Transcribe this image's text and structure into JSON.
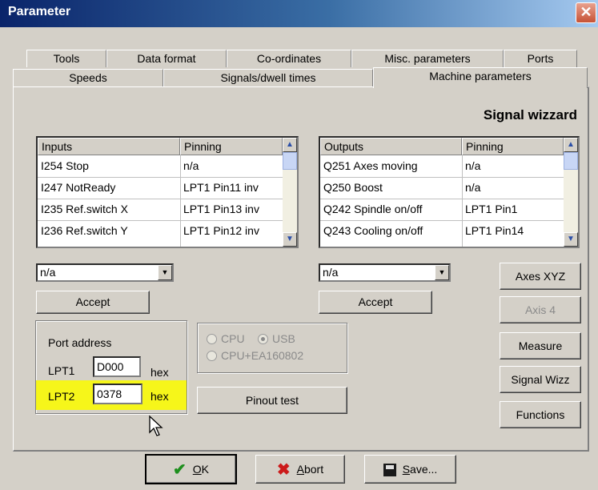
{
  "window": {
    "title": "Parameter"
  },
  "tabs_row1": [
    "Tools",
    "Data format",
    "Co-ordinates",
    "Misc. parameters",
    "Ports"
  ],
  "tabs_row2": [
    "Speeds",
    "Signals/dwell times",
    "Machine parameters"
  ],
  "active_tab": "Machine parameters",
  "heading": "Signal wizzard",
  "inputs": {
    "columns": [
      "Inputs",
      "Pinning"
    ],
    "rows": [
      [
        "I254 Stop",
        "n/a"
      ],
      [
        "I247 NotReady",
        "LPT1 Pin11 inv"
      ],
      [
        "I235 Ref.switch X",
        "LPT1 Pin13 inv"
      ],
      [
        "I236 Ref.switch Y",
        "LPT1 Pin12 inv"
      ]
    ],
    "combo_value": "n/a",
    "accept_label": "Accept"
  },
  "outputs": {
    "columns": [
      "Outputs",
      "Pinning"
    ],
    "rows": [
      [
        "Q251 Axes moving",
        "n/a"
      ],
      [
        "Q250 Boost",
        "n/a"
      ],
      [
        "Q242 Spindle on/off",
        "LPT1 Pin1"
      ],
      [
        "Q243 Cooling on/off",
        "LPT1 Pin14"
      ]
    ],
    "combo_value": "n/a",
    "accept_label": "Accept"
  },
  "port_address": {
    "label": "Port address",
    "lpt1_label": "LPT1",
    "lpt1_value": "D000",
    "lpt2_label": "LPT2",
    "lpt2_value": "0378",
    "unit": "hex"
  },
  "interface": {
    "cpu": "CPU",
    "usb": "USB",
    "cpu_ea": "CPU+EA160802",
    "selected": "USB"
  },
  "pinout_test": "Pinout test",
  "side_buttons": {
    "axes_xyz": "Axes XYZ",
    "axis4": "Axis 4",
    "measure": "Measure",
    "signal_wizz": "Signal Wizz",
    "functions": "Functions"
  },
  "footer": {
    "ok_first": "O",
    "ok_rest": "K",
    "abort_first": "A",
    "abort_rest": "bort",
    "save_first": "S",
    "save_rest": "ave..."
  },
  "colors": {
    "highlight": "#f6f61a",
    "title_gradient_start": "#0a246a"
  }
}
